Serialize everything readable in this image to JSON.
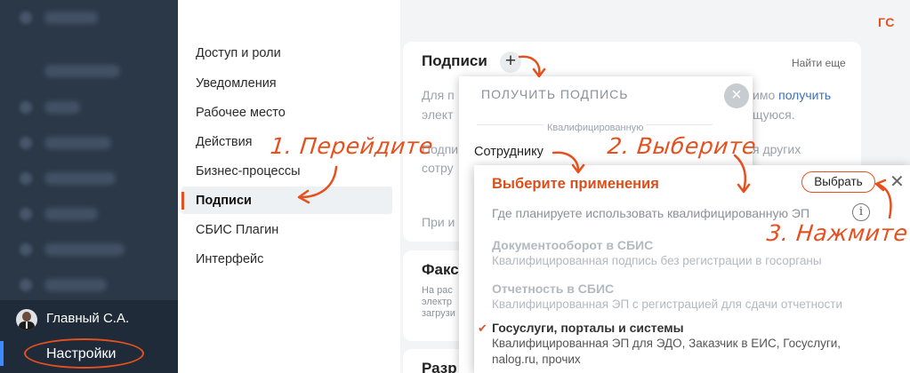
{
  "app": {
    "logo_text": "ГС"
  },
  "user": {
    "name": "Главный С.А.",
    "settings_label": "Настройки"
  },
  "settings_menu": {
    "items": [
      {
        "label": "Доступ и роли"
      },
      {
        "label": "Уведомления"
      },
      {
        "label": "Рабочее место"
      },
      {
        "label": "Действия"
      },
      {
        "label": "Бизнес-процессы"
      },
      {
        "label": "Подписи",
        "active": true
      },
      {
        "label": "СБИС Плагин"
      },
      {
        "label": "Интерфейс"
      }
    ]
  },
  "signatures_card": {
    "title": "Подписи",
    "plus": "+",
    "find_more": "Найти еще",
    "text_line1_prefix": "Для п",
    "text_line1_suffix": "имо",
    "text_line1_link": "получить",
    "text_line2_prefix": "элект",
    "text_line2_suffix": "щуюся.",
    "text_line3_prefix": "Подпи",
    "text_line3_suffix": "я других",
    "text_line4_prefix": "сотру",
    "text_line5_prefix": "При и"
  },
  "fax_card": {
    "title": "Факс",
    "line1": "На рас",
    "line2": "электр",
    "line3": "загрузи"
  },
  "third_card": {
    "title": "Разр"
  },
  "get_signature_popup": {
    "title": "ПОЛУЧИТЬ ПОДПИСЬ",
    "close": "×",
    "subtitle": "Квалифицированную",
    "employee": "Сотруднику"
  },
  "usage_popup": {
    "title": "Выберите применения",
    "choose_button": "Выбрать",
    "close": "✕",
    "hint": "Где планируете использовать квалифицированную ЭП",
    "info_icon": "i",
    "options": [
      {
        "title": "Документооборот в СБИС",
        "description": "Квалифицированная подпись без регистрации в госорганы",
        "selected": false
      },
      {
        "title": "Отчетность в СБИС",
        "description": "Квалифицированная ЭП с регистрацией для сдачи отчетности",
        "selected": false
      },
      {
        "title": "Госуслуги, порталы и системы",
        "description_line1": "Квалифицированная ЭП для ЭДО, Заказчик в ЕИС, Госуслуги,",
        "description_line2": "nalog.ru, прочих",
        "selected": true
      }
    ]
  },
  "annotations": {
    "step1": "1. Перейдите",
    "step2": "2. Выберите",
    "step3": "3. Нажмите"
  },
  "colors": {
    "accent": "#e6501e",
    "nav_bg": "#2b3847",
    "link": "#3f6fb5"
  }
}
